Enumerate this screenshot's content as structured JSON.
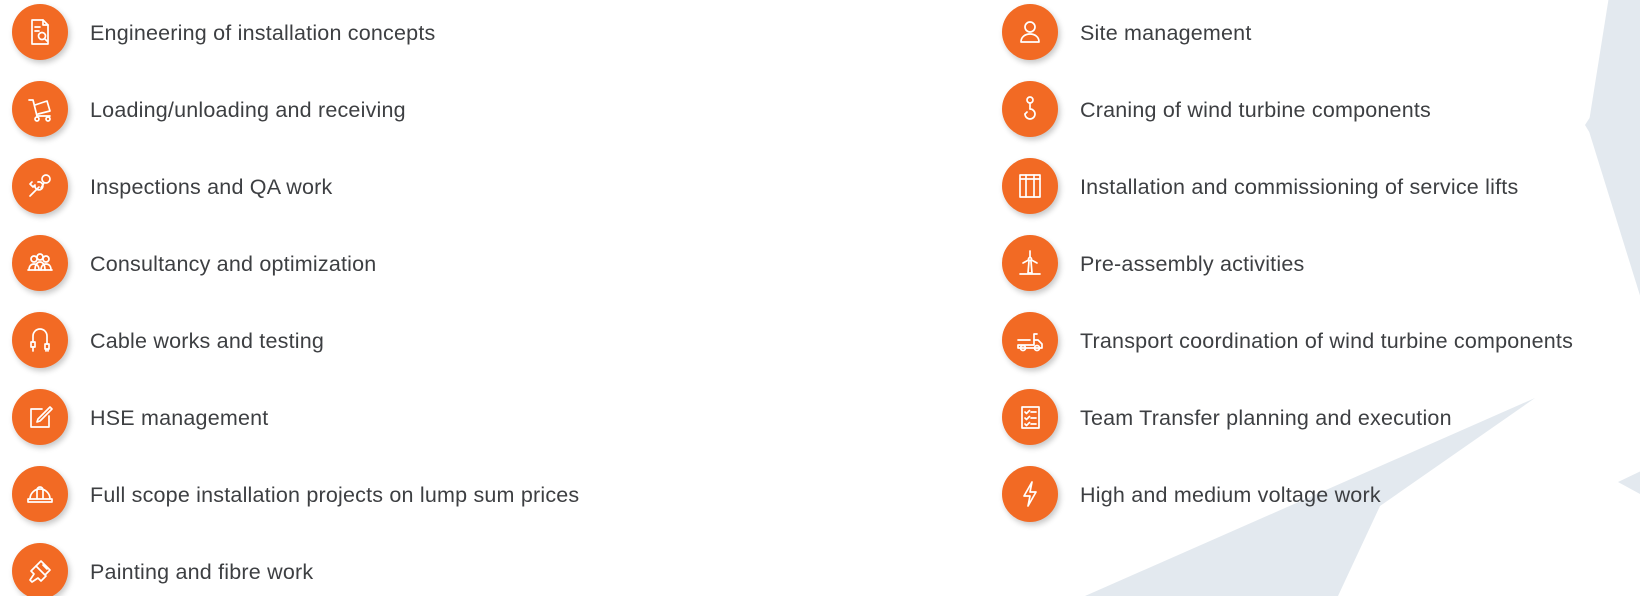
{
  "theme": {
    "accent": "#f26a24",
    "text": "#3d3f42",
    "background_shape": "#e3e9ef"
  },
  "left_services": [
    {
      "label": "Engineering of installation concepts",
      "icon": "document-search-icon"
    },
    {
      "label": "Loading/unloading and receiving",
      "icon": "hand-truck-icon"
    },
    {
      "label": "Inspections and QA work",
      "icon": "wrench-magnifier-icon"
    },
    {
      "label": "Consultancy and optimization",
      "icon": "people-group-icon"
    },
    {
      "label": "Cable works and testing",
      "icon": "cable-plug-icon"
    },
    {
      "label": "HSE management",
      "icon": "note-pencil-icon"
    },
    {
      "label": "Full scope installation projects on lump sum prices",
      "icon": "hard-hat-icon"
    },
    {
      "label": "Painting and fibre work",
      "icon": "paint-brush-icon"
    }
  ],
  "right_services": [
    {
      "label": "Site management",
      "icon": "person-icon"
    },
    {
      "label": "Craning of wind turbine components",
      "icon": "crane-hook-icon"
    },
    {
      "label": "Installation and commissioning of service lifts",
      "icon": "lift-icon"
    },
    {
      "label": "Pre-assembly activities",
      "icon": "wind-turbine-icon"
    },
    {
      "label": "Transport coordination of wind turbine components",
      "icon": "truck-icon"
    },
    {
      "label": "Team Transfer planning and execution",
      "icon": "checklist-icon"
    },
    {
      "label": "High and medium voltage work",
      "icon": "lightning-icon"
    }
  ]
}
